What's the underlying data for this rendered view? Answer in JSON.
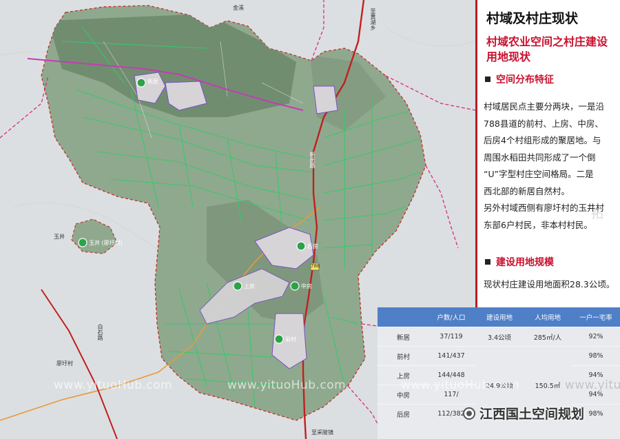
{
  "map": {
    "labels": {
      "north_town": "金溪",
      "highway_vertical": "至黄湖乡",
      "side_road": "新居路",
      "west_village": "玉井",
      "southwest_road": "白石路",
      "southwest_village": "廖圩村",
      "south_road": "至采陂镇"
    },
    "settlements": [
      {
        "name": "新居"
      },
      {
        "name": "玉井 (廖圩村)"
      },
      {
        "name": "后房"
      },
      {
        "name": "上房"
      },
      {
        "name": "中房"
      },
      {
        "name": "前村"
      }
    ],
    "highway_badge": "788",
    "colors": {
      "village_dot": "#2ca24a",
      "highway": "#c01f1f",
      "boundary": "#d92a86",
      "irrigation": "#37c96b"
    }
  },
  "panel": {
    "title": "村域及村庄现状",
    "subtitle": "村域农业空间之村庄建设用地现状",
    "section1": "空间分布特征",
    "paragraph1": [
      "村域居民点主要分两块，一是沿",
      "788县道的前村、上房、中房、",
      "后房4个村组形成的聚居地。与",
      "周围水稻田共同形成了一个倒",
      "“U”字型村庄空间格局。二是",
      "西北部的新居自然村。",
      "另外村域西侧有廖圩村的玉井村",
      "东部6户村民，非本村村民。"
    ],
    "section2": "建设用地规模",
    "paragraph2": "现状村庄建设用地面积28.3公顷。"
  },
  "table": {
    "headers": [
      "",
      "户数/人口",
      "建设用地",
      "人均用地",
      "一户一宅率"
    ],
    "rows": [
      {
        "name": "新居",
        "pop": "37/119",
        "land": "3.4公顷",
        "per": "285㎡/人",
        "rate": "92%"
      },
      {
        "name": "前村",
        "pop": "141/437",
        "land": "",
        "per": "",
        "rate": "98%"
      },
      {
        "name": "上房",
        "pop": "144/448",
        "land": "",
        "per": "",
        "rate": "94%"
      },
      {
        "name": "中房",
        "pop": "117/",
        "land": "",
        "per": "",
        "rate": "94%"
      },
      {
        "name": "后房",
        "pop": "112/382",
        "land": "",
        "per": "",
        "rate": "98%"
      }
    ],
    "merged_land": "24.9公顷",
    "merged_per": "150.5㎡"
  },
  "watermark": "www.yituoHub.com",
  "wechat": "江西国土空间规划",
  "decor_text": "拓"
}
